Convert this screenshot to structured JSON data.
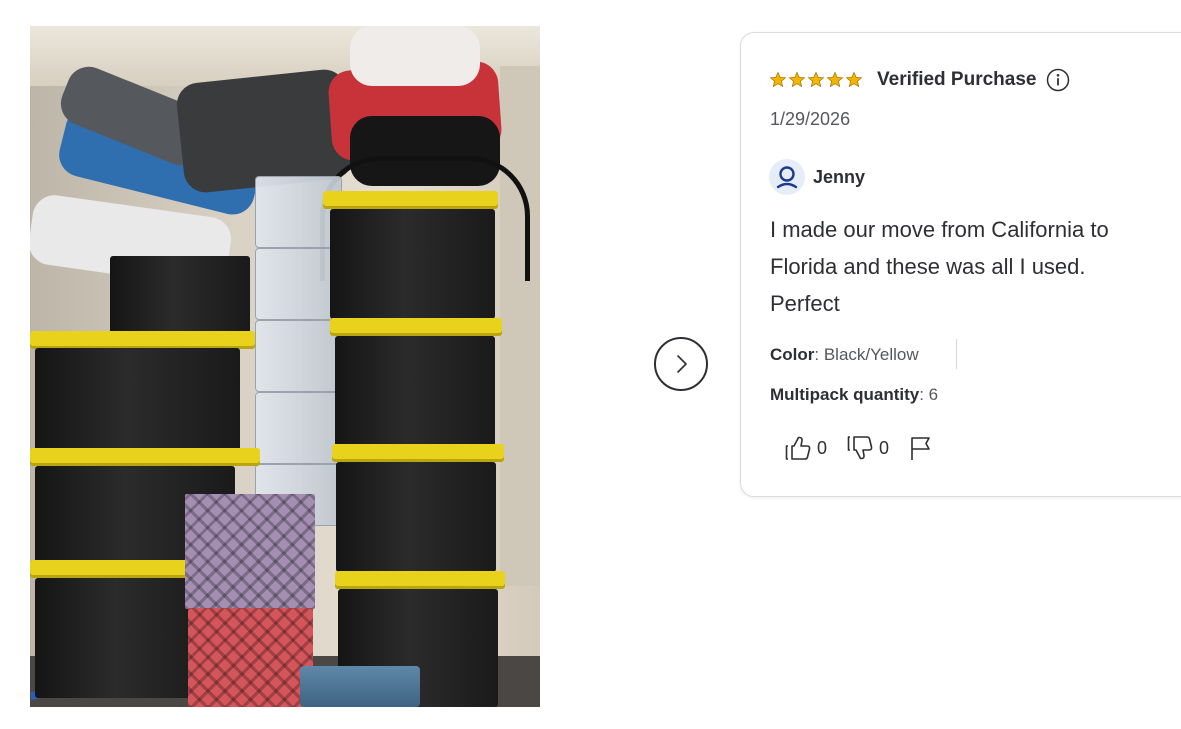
{
  "review": {
    "rating_stars": 5,
    "star_color": "#f5b400",
    "badge": "Verified Purchase",
    "date": "1/29/2026",
    "author": "Jenny",
    "text": "I made our move from California to Florida and these was all I used. Perfect",
    "attributes": {
      "color_label": "Color",
      "color_value": ": Black/Yellow",
      "qty_label": "Multipack quantity",
      "qty_value": ": 6"
    },
    "helpful_count": "0",
    "unhelpful_count": "0"
  },
  "icons": {
    "info": "info-icon",
    "next": "chevron-right-icon",
    "avatar": "user-icon",
    "thumbs_up": "thumbs-up-icon",
    "thumbs_down": "thumbs-down-icon",
    "flag": "flag-icon"
  },
  "colors": {
    "text": "#2e2f32",
    "avatar_bg": "#e6edf8",
    "avatar_icon": "#1a3a8f"
  }
}
